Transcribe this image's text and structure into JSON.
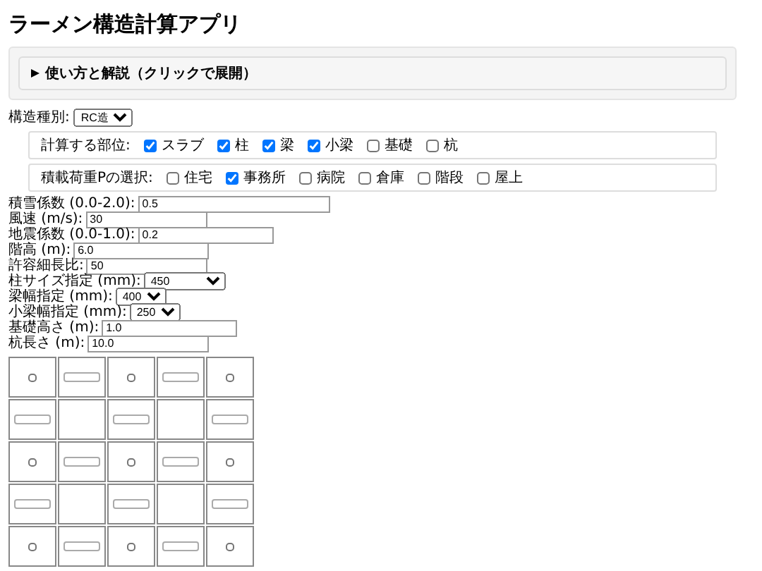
{
  "title": "ラーメン構造計算アプリ",
  "details": {
    "label": "使い方と解説（クリックで展開）",
    "expanded": false
  },
  "structure": {
    "label": "構造種別:",
    "value": "RC造"
  },
  "parts": {
    "label": "計算する部位:",
    "options": [
      {
        "label": "スラブ",
        "checked": true
      },
      {
        "label": "柱",
        "checked": true
      },
      {
        "label": "梁",
        "checked": true
      },
      {
        "label": "小梁",
        "checked": true
      },
      {
        "label": "基礎",
        "checked": false
      },
      {
        "label": "杭",
        "checked": false
      }
    ]
  },
  "loads": {
    "label": "積載荷重Pの選択:",
    "options": [
      {
        "label": "住宅",
        "checked": false
      },
      {
        "label": "事務所",
        "checked": true
      },
      {
        "label": "病院",
        "checked": false
      },
      {
        "label": "倉庫",
        "checked": false
      },
      {
        "label": "階段",
        "checked": false
      },
      {
        "label": "屋上",
        "checked": false
      }
    ]
  },
  "fields": [
    {
      "kind": "input",
      "label": "積雪係数 (0.0-2.0):",
      "value": "0.5"
    },
    {
      "kind": "input",
      "label": "風速 (m/s):",
      "value": "30"
    },
    {
      "kind": "input",
      "label": "地震係数 (0.0-1.0):",
      "value": "0.2"
    },
    {
      "kind": "input",
      "label": "階高 (m):",
      "value": "6.0"
    },
    {
      "kind": "input",
      "label": "許容細長比:",
      "value": "50"
    },
    {
      "kind": "select",
      "label": "柱サイズ指定 (mm):",
      "value": "450"
    },
    {
      "kind": "select",
      "label": "梁幅指定 (mm):",
      "value": "400"
    },
    {
      "kind": "select",
      "label": "小梁幅指定 (mm):",
      "value": "250"
    },
    {
      "kind": "input",
      "label": "基礎高さ (m):",
      "value": "1.0"
    },
    {
      "kind": "input",
      "label": "杭長さ (m):",
      "value": "10.0"
    }
  ],
  "grid": {
    "rows": [
      {
        "cells": [
          {
            "kind": "checkbox",
            "checked": false
          },
          {
            "kind": "input"
          },
          {
            "kind": "checkbox",
            "checked": false
          },
          {
            "kind": "input"
          },
          {
            "kind": "checkbox",
            "checked": false
          }
        ]
      },
      {
        "cells": [
          {
            "kind": "input"
          },
          {
            "kind": "empty"
          },
          {
            "kind": "input"
          },
          {
            "kind": "empty"
          },
          {
            "kind": "input"
          }
        ]
      },
      {
        "cells": [
          {
            "kind": "checkbox",
            "checked": false
          },
          {
            "kind": "input"
          },
          {
            "kind": "checkbox",
            "checked": false
          },
          {
            "kind": "input"
          },
          {
            "kind": "checkbox",
            "checked": false
          }
        ]
      },
      {
        "cells": [
          {
            "kind": "input"
          },
          {
            "kind": "empty"
          },
          {
            "kind": "input"
          },
          {
            "kind": "empty"
          },
          {
            "kind": "input"
          }
        ]
      },
      {
        "cells": [
          {
            "kind": "checkbox",
            "checked": false
          },
          {
            "kind": "input"
          },
          {
            "kind": "checkbox",
            "checked": false
          },
          {
            "kind": "input"
          },
          {
            "kind": "checkbox",
            "checked": false
          }
        ]
      }
    ]
  }
}
